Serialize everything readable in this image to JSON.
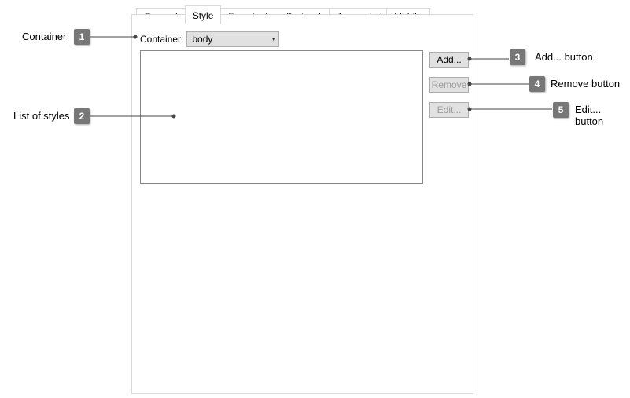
{
  "tabs": {
    "general": "General",
    "style": "Style",
    "favicon": "Favorite Icon (favicon)",
    "javascript": "Javascript",
    "mobile": "Mobile"
  },
  "container": {
    "label": "Container:",
    "value": "body"
  },
  "buttons": {
    "add": "Add...",
    "remove": "Remove",
    "edit": "Edit..."
  },
  "callouts": {
    "c1": {
      "num": "1",
      "text": "Container"
    },
    "c2": {
      "num": "2",
      "text": "List of styles"
    },
    "c3": {
      "num": "3",
      "text": "Add... button"
    },
    "c4": {
      "num": "4",
      "text": "Remove button"
    },
    "c5": {
      "num": "5",
      "text": "Edit... button"
    }
  }
}
